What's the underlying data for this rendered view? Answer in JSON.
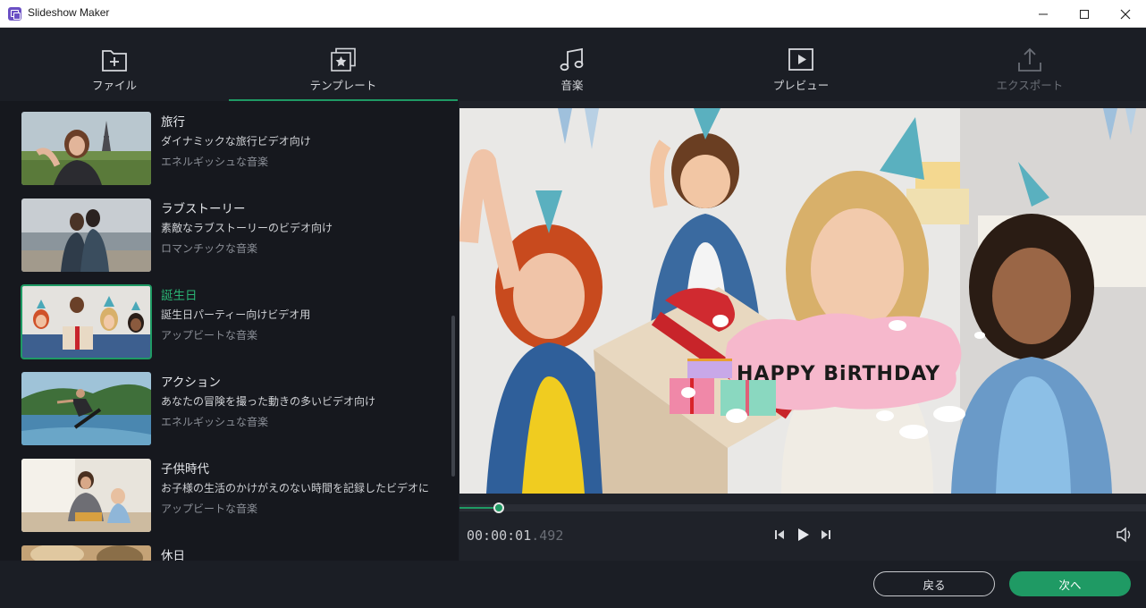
{
  "window": {
    "title": "Slideshow Maker"
  },
  "nav": {
    "tabs": [
      {
        "label": "ファイル",
        "icon": "folder-add-icon",
        "state": "normal"
      },
      {
        "label": "テンプレート",
        "icon": "template-star-icon",
        "state": "active"
      },
      {
        "label": "音楽",
        "icon": "music-note-icon",
        "state": "normal"
      },
      {
        "label": "プレビュー",
        "icon": "play-preview-icon",
        "state": "normal"
      },
      {
        "label": "エクスポート",
        "icon": "export-upload-icon",
        "state": "disabled"
      }
    ]
  },
  "templates": [
    {
      "name": "旅行",
      "desc": "ダイナミックな旅行ビデオ向け",
      "music": "エネルギッシュな音楽"
    },
    {
      "name": "ラブストーリー",
      "desc": "素敵なラブストーリーのビデオ向け",
      "music": "ロマンチックな音楽"
    },
    {
      "name": "誕生日",
      "desc": "誕生日パーティー向けビデオ用",
      "music": "アップビートな音楽",
      "selected": true
    },
    {
      "name": "アクション",
      "desc": "あなたの冒険を撮った動きの多いビデオ向け",
      "music": "エネルギッシュな音楽"
    },
    {
      "name": "子供時代",
      "desc": "お子様の生活のかけがえのない時間を記録したビデオに",
      "music": "アップビートな音楽"
    },
    {
      "name": "休日",
      "desc": "",
      "music": ""
    }
  ],
  "preview": {
    "overlay_text": "HAPPY BiRTHDAY",
    "timecode_main": "00:00:01",
    "timecode_ms": ".492",
    "progress": 0.057
  },
  "footer": {
    "back_label": "戻る",
    "next_label": "次へ"
  },
  "colors": {
    "accent": "#1f9a64",
    "background": "#1b1e25",
    "panel": "#16181e"
  }
}
